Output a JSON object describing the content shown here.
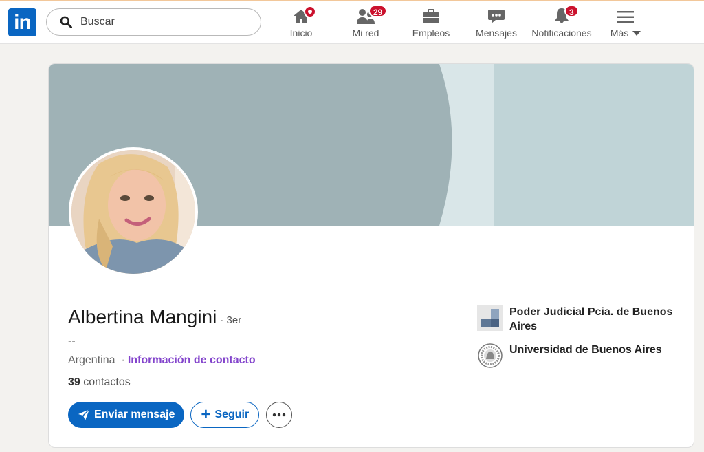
{
  "app": {
    "logo_text": "in",
    "brand_color": "#0a66c2"
  },
  "search": {
    "placeholder": "Buscar",
    "value": ""
  },
  "nav": [
    {
      "label": "Inicio",
      "icon": "home-icon",
      "badge": "dot"
    },
    {
      "label": "Mi red",
      "icon": "people-icon",
      "badge": "29"
    },
    {
      "label": "Empleos",
      "icon": "briefcase-icon",
      "badge": null
    },
    {
      "label": "Mensajes",
      "icon": "chat-icon",
      "badge": null
    },
    {
      "label": "Notificaciones",
      "icon": "bell-icon",
      "badge": "3"
    },
    {
      "label": "Más",
      "icon": "menu-icon",
      "badge": null
    }
  ],
  "profile": {
    "name": "Albertina Mangini",
    "degree": "· 3er",
    "headline": "--",
    "location": "Argentina",
    "location_sep": "·",
    "contact_link": "Información de contacto",
    "connections_count": "39",
    "connections_label": "contactos"
  },
  "actions": {
    "message_label": "Enviar mensaje",
    "follow_label": "Seguir",
    "more_icon": "more-dots-icon"
  },
  "orgs": [
    {
      "name": "Poder Judicial Pcia. de Buenos Aires",
      "icon": "company-logo"
    },
    {
      "name": "Universidad de Buenos Aires",
      "icon": "university-seal"
    }
  ],
  "colors": {
    "badge": "#cb112d",
    "link_purple": "#8344cc",
    "banner_dark": "#9fb2b6",
    "banner_light": "#c0d4d7"
  }
}
